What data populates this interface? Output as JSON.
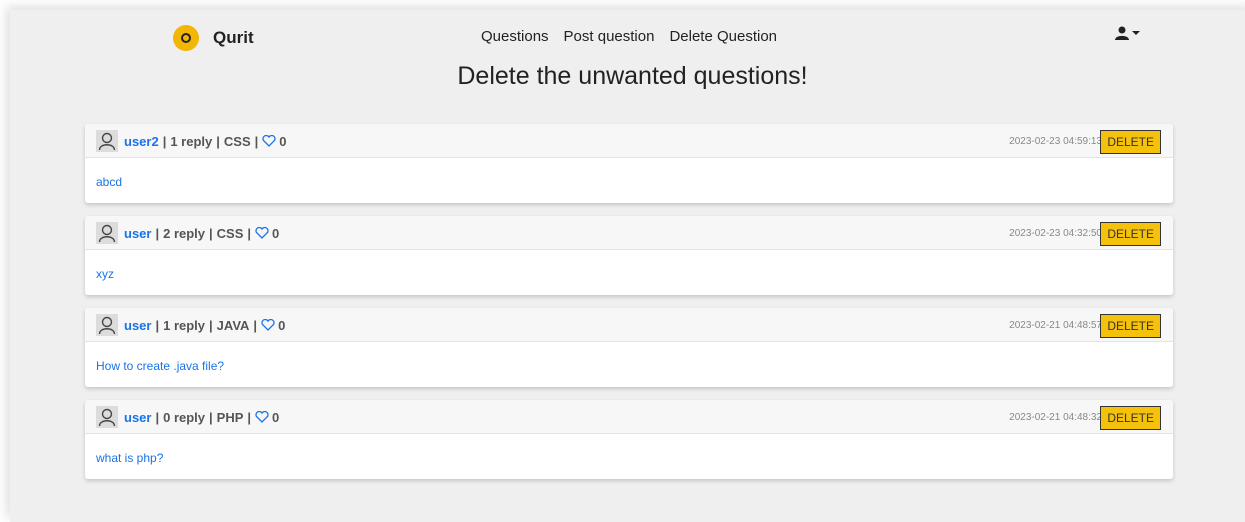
{
  "nav": {
    "brand": "Qurit",
    "links": [
      "Questions",
      "Post question",
      "Delete Question"
    ]
  },
  "page_title": "Delete the unwanted questions!",
  "questions": [
    {
      "user": "user2",
      "replies": "1 reply",
      "tag": "CSS",
      "likes": "0",
      "timestamp": "2023-02-23 04:59:13",
      "delete_label": "DELETE",
      "text": "abcd"
    },
    {
      "user": "user",
      "replies": "2 reply",
      "tag": "CSS",
      "likes": "0",
      "timestamp": "2023-02-23 04:32:50",
      "delete_label": "DELETE",
      "text": "xyz"
    },
    {
      "user": "user",
      "replies": "1 reply",
      "tag": "JAVA",
      "likes": "0",
      "timestamp": "2023-02-21 04:48:57",
      "delete_label": "DELETE",
      "text": "How to create .java file?"
    },
    {
      "user": "user",
      "replies": "0 reply",
      "tag": "PHP",
      "likes": "0",
      "timestamp": "2023-02-21 04:48:32",
      "delete_label": "DELETE",
      "text": "what is php?"
    }
  ],
  "colors": {
    "accent": "#f4c20d",
    "link": "#1a73e8",
    "background": "#efefef"
  },
  "icons": {
    "logo": "brand-logo-icon",
    "user": "user-icon",
    "avatar": "avatar-icon",
    "like": "heart-icon"
  }
}
